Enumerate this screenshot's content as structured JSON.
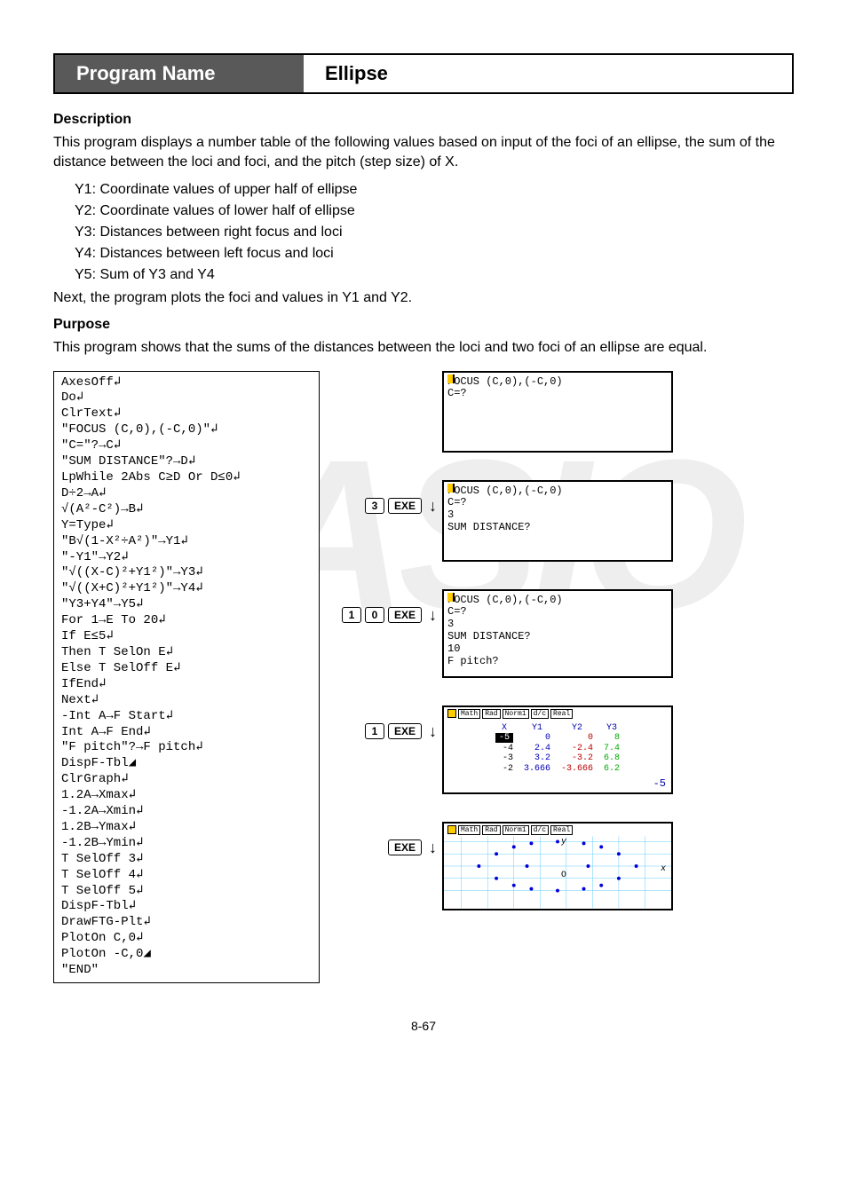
{
  "header": {
    "left": "Program Name",
    "right": "Ellipse"
  },
  "sections": {
    "description_title": "Description",
    "description_body": "This program displays a number table of the following values based on input of the foci of an ellipse, the sum of the distance between the loci and foci, and the pitch (step size) of X.",
    "y1": "Y1: Coordinate values of upper half of ellipse",
    "y2": "Y2: Coordinate values of lower half of ellipse",
    "y3": "Y3: Distances between right focus and loci",
    "y4": "Y4: Distances between left focus and loci",
    "y5": "Y5: Sum of Y3 and Y4",
    "next_text": "Next, the program plots the foci and values in Y1 and Y2.",
    "purpose_title": "Purpose",
    "purpose_body": "This program shows that the sums of the distances between the loci and two foci of an ellipse are equal."
  },
  "program_code": "AxesOff↲\nDo↲\nClrText↲\n\"FOCUS (C,0),(-C,0)\"↲\n\"C=\"?→C↲\n\"SUM DISTANCE\"?→D↲\nLpWhile 2Abs C≥D Or D≤0↲\nD÷2→A↲\n√(A²-C²)→B↲\nY=Type↲\n\"B√(1-X²÷A²)\"→Y1↲\n\"-Y1\"→Y2↲\n\"√((X-C)²+Y1²)\"→Y3↲\n\"√((X+C)²+Y1²)\"→Y4↲\n\"Y3+Y4\"→Y5↲\nFor 1→E To 20↲\nIf E≤5↲\nThen T SelOn E↲\nElse T SelOff E↲\nIfEnd↲\nNext↲\n-Int A→F Start↲\nInt A→F End↲\n\"F pitch\"?→F pitch↲\nDispF-Tbl◢\nClrGraph↲\n1.2A→Xmax↲\n-1.2A→Xmin↲\n1.2B→Ymax↲\n-1.2B→Ymin↲\nT SelOff 3↲\nT SelOff 4↲\nT SelOff 5↲\nDispF-Tbl↲\nDrawFTG-Plt↲\nPlotOn C,0↲\nPlotOn -C,0◢\n\"END\"",
  "steps": {
    "s1_keys": [
      "3",
      "EXE"
    ],
    "s2_keys": [
      "1",
      "0",
      "EXE"
    ],
    "s3_keys": [
      "1",
      "EXE"
    ],
    "s4_keys": [
      "EXE"
    ]
  },
  "screen1": {
    "line1": "FOCUS (C,0),(-C,0)",
    "line2": "C=?"
  },
  "screen2": {
    "line1": "FOCUS (C,0),(-C,0)",
    "line2": "C=?",
    "line3": "3",
    "line4": "SUM DISTANCE?"
  },
  "screen3": {
    "line1": "FOCUS (C,0),(-C,0)",
    "line2": "C=?",
    "line3": "3",
    "line4": "SUM DISTANCE?",
    "line5": "10",
    "line6": "F pitch?"
  },
  "screen_table": {
    "badges": [
      "Math",
      "Rad",
      "Norm1",
      "d/c",
      "Real"
    ],
    "headers": [
      "X",
      "Y1",
      "Y2",
      "Y3"
    ],
    "rows": [
      [
        "-5",
        "0",
        "0",
        "8"
      ],
      [
        "-4",
        "2.4",
        "-2.4",
        "7.4"
      ],
      [
        "-3",
        "3.2",
        "-3.2",
        "6.8"
      ],
      [
        "-2",
        "3.666",
        "-3.666",
        "6.2"
      ]
    ],
    "corner_value": "-5"
  },
  "screen_graph": {
    "badges": [
      "Math",
      "Rad",
      "Norm1",
      "d/c",
      "Real"
    ],
    "x_axis_label": "x",
    "y_axis_label": "y",
    "center_label": "O"
  },
  "page_number": "8-67"
}
